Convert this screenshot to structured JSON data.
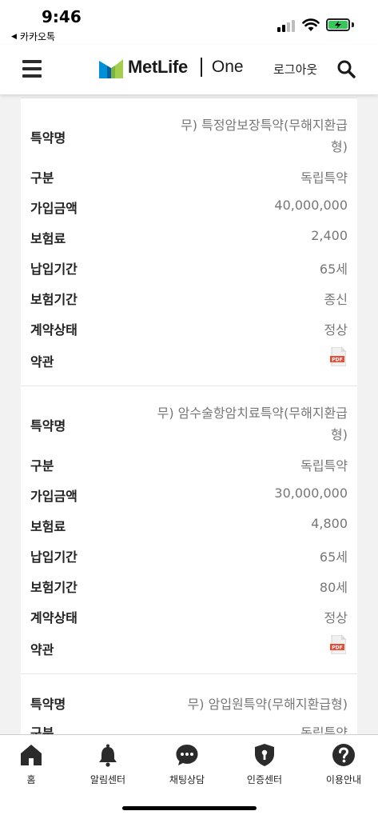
{
  "status_bar": {
    "time": "9:46",
    "back_app": "카카오톡"
  },
  "header": {
    "logo_text": "MetLife",
    "logo_sub": "One",
    "logout_label": "로그아웃"
  },
  "labels": {
    "name": "특약명",
    "category": "구분",
    "amount": "가입금액",
    "premium": "보험료",
    "payment_period": "납입기간",
    "coverage_period": "보험기간",
    "status": "계약상태",
    "terms": "약관"
  },
  "contracts": [
    {
      "name": "무) 특정암보장특약(무해지환급형)",
      "category": "독립특약",
      "amount": "40,000,000",
      "premium": "2,400",
      "payment_period": "65세",
      "coverage_period": "종신",
      "status": "정상",
      "terms_icon": "pdf-icon"
    },
    {
      "name": "무) 암수술항암치료특약(무해지환급형)",
      "category": "독립특약",
      "amount": "30,000,000",
      "premium": "4,800",
      "payment_period": "65세",
      "coverage_period": "80세",
      "status": "정상",
      "terms_icon": "pdf-icon"
    },
    {
      "name": "무) 암입원특약(무해지환급형)",
      "category": "독립특약"
    }
  ],
  "bottom_nav": [
    {
      "label": "홈",
      "icon": "home-icon"
    },
    {
      "label": "알림센터",
      "icon": "bell-icon"
    },
    {
      "label": "채팅상담",
      "icon": "chat-icon"
    },
    {
      "label": "인증센터",
      "icon": "shield-lock-icon"
    },
    {
      "label": "이용안내",
      "icon": "help-icon"
    }
  ],
  "colors": {
    "brand_blue": "#0090da",
    "brand_green": "#a4ce4e",
    "pdf_red": "#e94b35"
  }
}
